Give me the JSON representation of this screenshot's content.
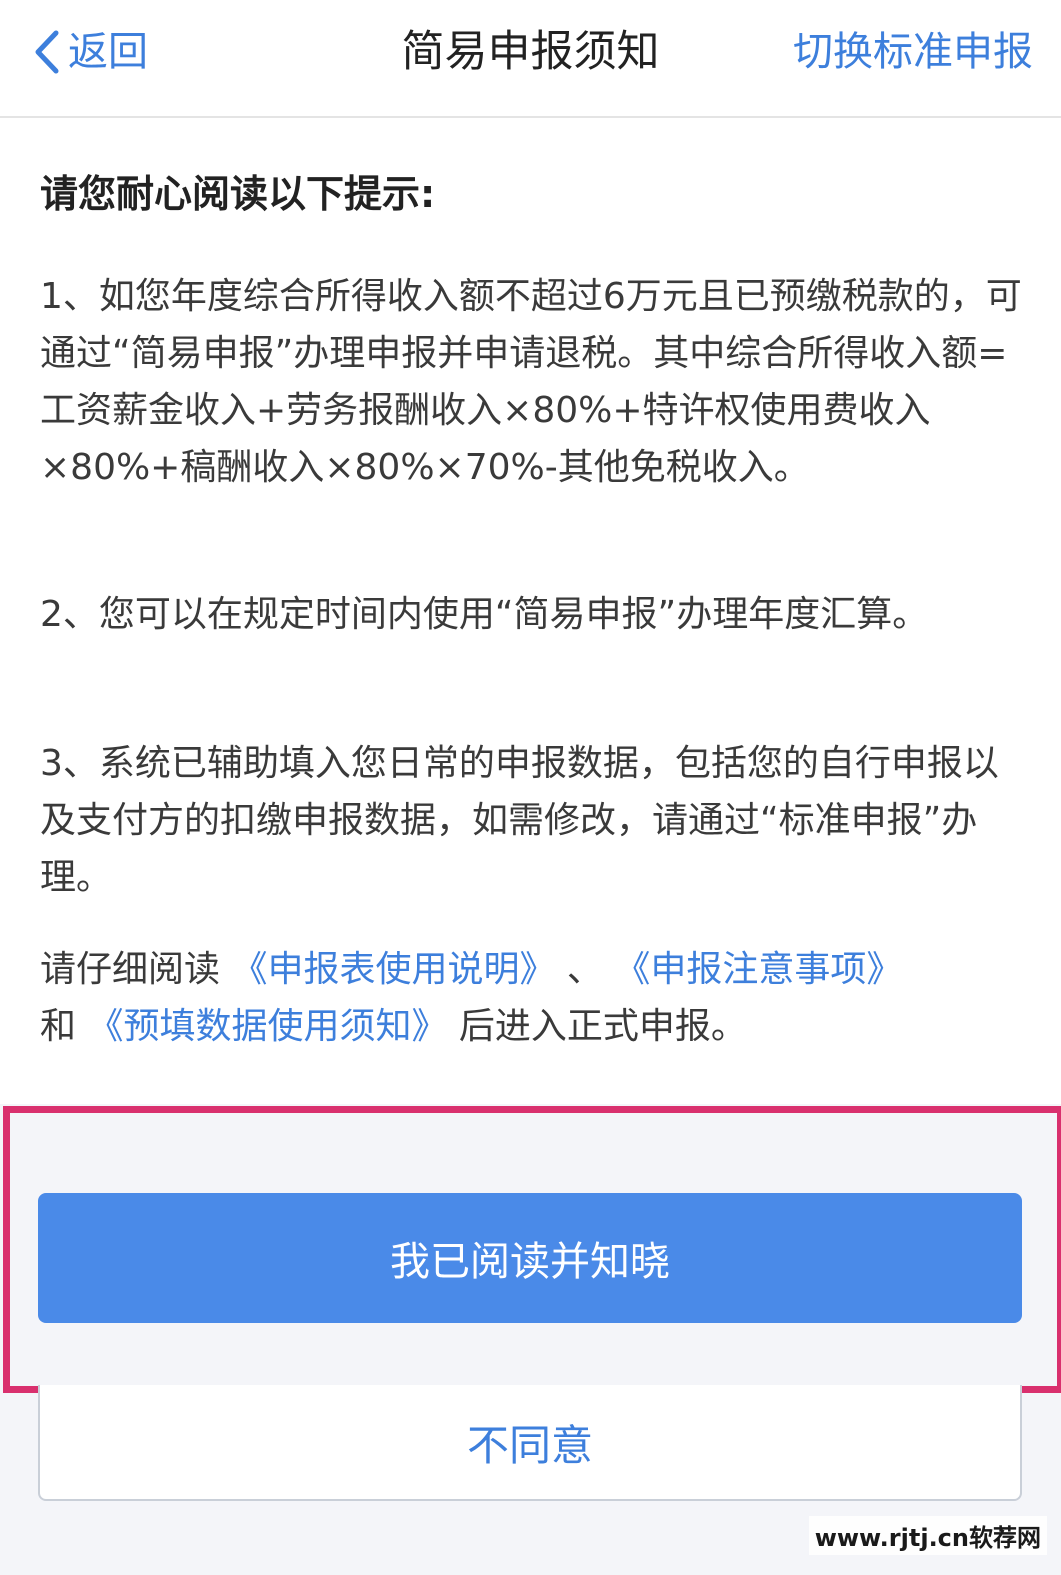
{
  "navbar": {
    "back_label": "返回",
    "title": "简易申报须知",
    "right_action": "切换标准申报"
  },
  "content": {
    "heading": "请您耐心阅读以下提示:",
    "item1": "1、如您年度综合所得收入额不超过6万元且已预缴税款的，可通过“简易申报”办理申报并申请退税。其中综合所得收入额=工资薪金收入+劳务报酬收入×80%+特许权使用费收入×80%+稿酬收入×80%×70%-其他免税收入。",
    "item2": "2、您可以在规定时间内使用“简易申报”办理年度汇算。",
    "item3": "3、系统已辅助填入您日常的申报数据，包括您的自行申报以及支付方的扣缴申报数据，如需修改，请通过“标准申报”办理。",
    "notice": {
      "prefix": "请仔细阅读 ",
      "link1": "《申报表使用说明》",
      "sep": " 、 ",
      "link2": "《申报注意事项》",
      "and": "和 ",
      "link3": "《预填数据使用须知》",
      "suffix": " 后进入正式申报。"
    }
  },
  "buttons": {
    "agree": "我已阅读并知晓",
    "disagree": "不同意"
  },
  "watermark": "www.rjtj.cn软荐网",
  "colors": {
    "accent": "#3d7fdc",
    "primary_button": "#4a8ae8",
    "highlight": "#d9306e"
  },
  "icons": {
    "back": "chevron-left-icon"
  }
}
